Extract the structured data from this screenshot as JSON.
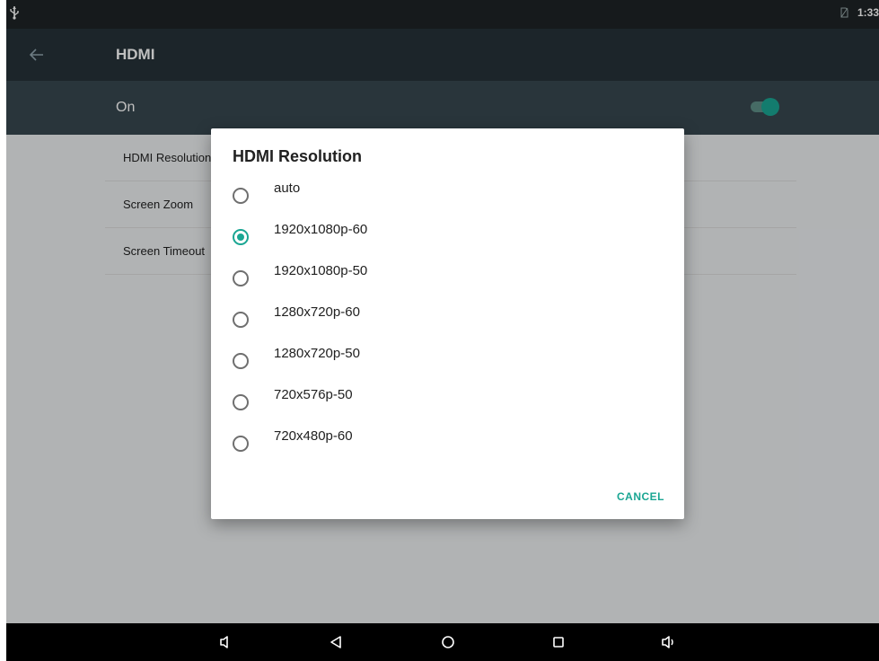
{
  "status_bar": {
    "time": "1:33"
  },
  "app_bar": {
    "title": "HDMI"
  },
  "switch_bar": {
    "label": "On",
    "enabled": true
  },
  "settings": {
    "items": [
      {
        "label": "HDMI Resolution"
      },
      {
        "label": "Screen Zoom"
      },
      {
        "label": "Screen Timeout"
      }
    ]
  },
  "dialog": {
    "title": "HDMI Resolution",
    "options": [
      {
        "label": "auto",
        "selected": false
      },
      {
        "label": "1920x1080p-60",
        "selected": true
      },
      {
        "label": "1920x1080p-50",
        "selected": false
      },
      {
        "label": "1280x720p-60",
        "selected": false
      },
      {
        "label": "1280x720p-50",
        "selected": false
      },
      {
        "label": "720x576p-50",
        "selected": false
      },
      {
        "label": "720x480p-60",
        "selected": false
      }
    ],
    "cancel_label": "CANCEL"
  },
  "colors": {
    "accent": "#1aa693",
    "toolbar": "#263238",
    "switch_bar": "#37474f"
  },
  "nav_bar": {
    "icons": [
      "volume-down-icon",
      "back-icon",
      "home-icon",
      "recents-icon",
      "volume-up-icon"
    ]
  }
}
